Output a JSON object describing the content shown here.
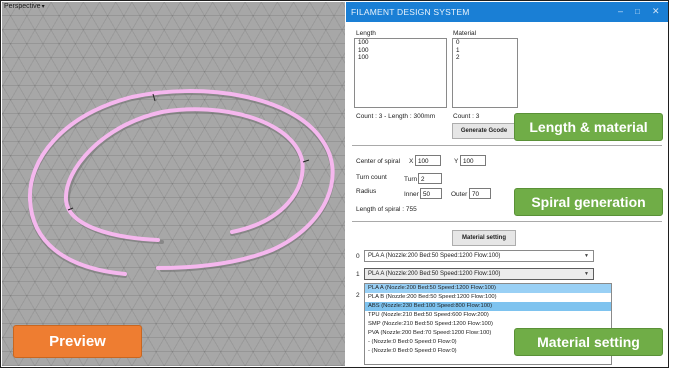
{
  "viewport": {
    "label": "Perspective"
  },
  "window": {
    "title": "FILAMENT DESIGN SYSTEM",
    "buttons": {
      "minimize": "–",
      "maximize": "□",
      "close": "✕"
    }
  },
  "length_material": {
    "length_label": "Length",
    "material_label": "Material",
    "lengths": [
      "100",
      "100",
      "100"
    ],
    "materials": [
      "0",
      "1",
      "2"
    ],
    "count_length_text": "Count : 3 -  Length : 300mm",
    "count_text": "Count : 3",
    "generate_button": "Generate Gcode"
  },
  "spiral": {
    "center_label": "Center of spiral",
    "x_label": "X",
    "x_value": "100",
    "y_label": "Y",
    "y_value": "100",
    "turn_count_label": "Turn count",
    "turn_label": "Turn",
    "turn_value": "2",
    "radius_label": "Radius",
    "inner_label": "Inner",
    "inner_value": "50",
    "outer_label": "Outer",
    "outer_value": "70",
    "length_text": "Length of spiral : 755"
  },
  "material_setting": {
    "button": "Material setting",
    "rows": [
      {
        "index": "0",
        "value": "PLA A (Nozzle:200 Bed:50 Speed:1200 Flow:100)"
      },
      {
        "index": "1",
        "value": "PLA A (Nozzle:200 Bed:50 Speed:1200 Flow:100)"
      },
      {
        "index": "2",
        "value": ""
      }
    ],
    "options": [
      "PLA A (Nozzle:200 Bed:50 Speed:1200 Flow:100)",
      "PLA B (Nozzle:200 Bed:50 Speed:1200 Flow:100)",
      "ABS (Nozzle:230 Bed:100 Speed:800 Flow:100)",
      "TPU (Nozzle:210 Bed:50 Speed:600 Flow:200)",
      "SMP (Nozzle:210 Bed:50 Speed:1200 Flow:100)",
      "PVA (Nozzle:200 Bed:70 Speed:1200 Flow:100)",
      "- (Nozzle:0 Bed:0 Speed:0 Flow:0)",
      "- (Nozzle:0 Bed:0 Speed:0 Flow:0)"
    ],
    "selected_option_index": 0,
    "highlighted_option_index": 2
  },
  "callouts": {
    "preview": "Preview",
    "length_material": "Length & material",
    "spiral_generation": "Spiral generation",
    "material_setting": "Material setting"
  },
  "colors": {
    "titlebar": "#1a7fd5",
    "callout_orange": "#ee7d31",
    "callout_green": "#70ad47",
    "spiral_pink": "#f5b7ee",
    "dropdown_selected": "#99d0f5",
    "dropdown_highlight": "#7ec3ef"
  }
}
